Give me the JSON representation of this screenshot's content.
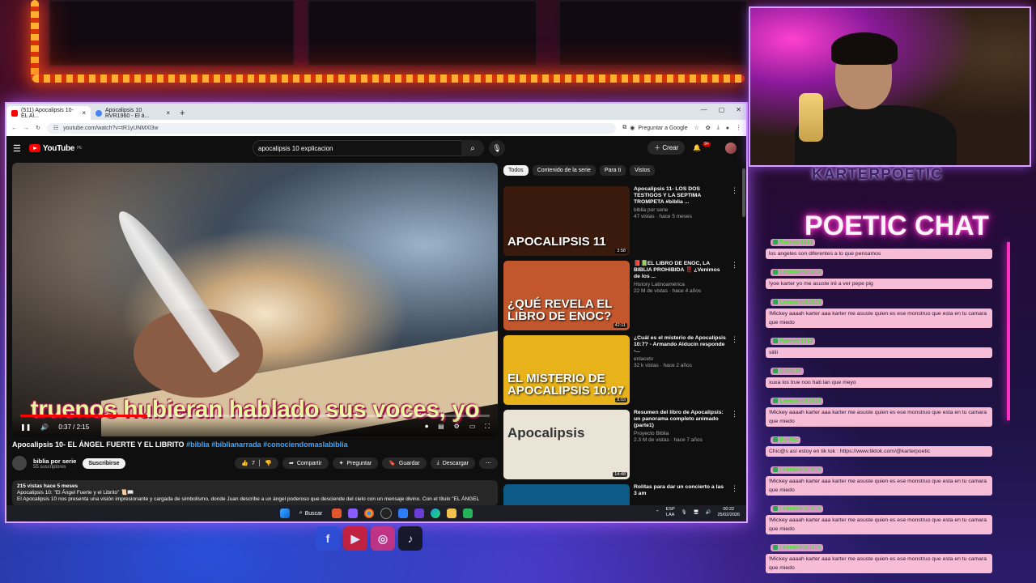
{
  "browser": {
    "tabs": [
      {
        "label": "(511) Apocalipsis 10- EL Al...",
        "icon": "youtube-icon",
        "active": true
      },
      {
        "label": "Apocalipsis 10 RVR1960 - El á...",
        "icon": "google-icon",
        "active": false
      }
    ],
    "url": "youtube.com/watch?v=tR1yUNMXl3w",
    "ask_google": "Preguntar a Google"
  },
  "youtube": {
    "logo": "YouTube",
    "country": "PE",
    "search_value": "apocalipsis 10 explicacion",
    "create_label": "Crear",
    "notif_count": "9+",
    "player": {
      "subtitle": "truenos hubieran hablado sus voces, yo",
      "time": "0:37 / 2:15",
      "progress": 0.27
    },
    "video": {
      "title": "Apocalipsis 10- EL ÁNGEL FUERTE Y EL LIBRITO ",
      "hashtags": "#biblia #biblianarrada #conociendomaslabiblia",
      "channel": "biblia por serie",
      "subscribers": "55 suscriptores",
      "subscribe_label": "Suscribirse",
      "likes": "7",
      "actions": [
        "Compartir",
        "Preguntar",
        "Guardar",
        "Descargar"
      ],
      "desc_stats": "215 vistas  hace 5 meses",
      "desc_line1": "Apocalipsis 10: \"El Ángel Fuerte y el Librito\" 📜📖",
      "desc_line2": "El Apocalipsis 10 nos presenta una visión impresionante y cargada de simbolismo, donde Juan describe a un ángel poderoso que desciende del cielo con un mensaje divino. Con el título \"EL ÁNGEL"
    },
    "chips": [
      "Todos",
      "Contenido de la serie",
      "Para ti",
      "Vistos"
    ],
    "recommendations": [
      {
        "title": "Apocalipsis 11- LOS DOS TESTIGOS Y LA SEPTIMA TROMPETA    #biblia ...",
        "channel": "biblia por serie",
        "meta": "47 vistas · hace 5 meses",
        "duration": "3:58",
        "thumb_text": "APOCALIPSIS 11",
        "thumb_color": "#3a1a0c"
      },
      {
        "title": "📕📗EL LIBRO DE ENOC, LA BIBLIA PROHIBIDA ‼️ ¿Venimos de los ...",
        "channel": "History Latinoamérica",
        "meta": "22 M de vistas · hace 4 años",
        "duration": "42:11",
        "thumb_text": "¿QUÉ REVELA EL LIBRO DE ENOC?",
        "thumb_color": "#c2572d"
      },
      {
        "title": "¿Cuál es el misterio de Apocalipsis 10:7? - Armando Alducin responde -...",
        "channel": "enlacetv",
        "meta": "32 k vistas · hace 2 años",
        "duration": "8:03",
        "thumb_text": "EL MISTERIO DE APOCALIPSIS 10:07",
        "thumb_color": "#e8b21a"
      },
      {
        "title": "Resumen del libro de Apocalipsis: un panorama completo animado (parte1)",
        "channel": "Proyecto Biblia",
        "meta": "2.3 M de vistas · hace 7 años",
        "duration": "14:48",
        "thumb_text": "Apocalipsis",
        "thumb_color": "#e9e4d6"
      },
      {
        "title": "Rolitas para dar un concierto a las 3 am",
        "channel": "",
        "meta": "",
        "duration": "",
        "thumb_text": "",
        "thumb_color": "#0e5a86"
      }
    ]
  },
  "taskbar": {
    "search_label": "Buscar",
    "lang": "ESP",
    "region": "LAA",
    "time": "00:22",
    "date": "25/02/2026"
  },
  "stream": {
    "username": "KARTERPOETIC",
    "chat_title": "POETIC CHAT",
    "messages": [
      {
        "user": "Forever1810",
        "text": "los angeles son diferentes a lo que pensamos"
      },
      {
        "user": "Leonardo10101",
        "text": "!yoe karter yo me asuste iré a ver pepe pig"
      },
      {
        "user": "Leonardo10101",
        "text": "!Mickey aaaah karter aaa karter me asuste quien es ese monstruo que esta en tu camara que miedo"
      },
      {
        "user": "Forever1810",
        "text": "siiiii"
      },
      {
        "user": "Oidak18",
        "text": "xuxa los true noo hab lan que meyo"
      },
      {
        "user": "Leonardo10101",
        "text": "!Mickey aaaah karter aaa karter me asuste quien es ese monstruo que esta en tu camara que miedo"
      },
      {
        "user": "BotRix",
        "text": "Chic@s así estoy en tik tok : https://www.tiktok.com/@karterpoetic"
      },
      {
        "user": "Leonardo10101",
        "text": "!Mickey aaaah karter aaa karter me asuste quien es ese monstruo que esta en tu camara que miedo"
      },
      {
        "user": "Leonardo10101",
        "text": "!Mickey aaaah karter aaa karter me asuste quien es ese monstruo que esta en tu camara que miedo"
      },
      {
        "user": "Leonardo10101",
        "text": "!Mickey aaaah karter aaa karter me asuste quien es ese monstruo que esta en tu camara que miedo"
      },
      {
        "user": "Leonardo10101",
        "text": "!Mickey aaaah karter aaa karter me asuste quien es ese monstruo que esta en tu camara que miedo"
      }
    ],
    "socials": [
      {
        "name": "facebook-icon",
        "glyph": "f",
        "color": "#2d4fd6"
      },
      {
        "name": "youtube-icon",
        "glyph": "▶",
        "color": "#d91c2a"
      },
      {
        "name": "instagram-icon",
        "glyph": "◎",
        "color": "#d6317a"
      },
      {
        "name": "tiktok-icon",
        "glyph": "♪",
        "color": "#111111"
      }
    ]
  }
}
